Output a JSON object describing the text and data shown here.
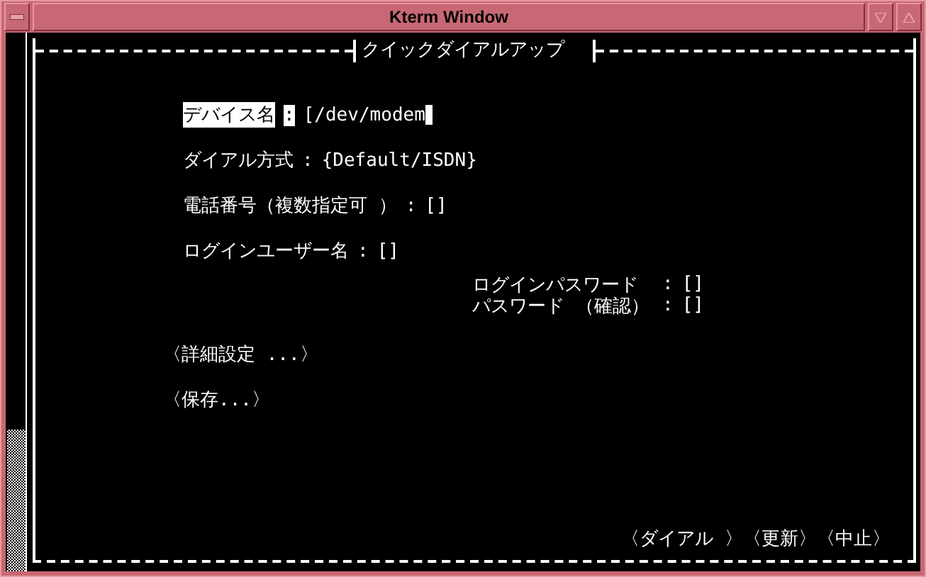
{
  "window": {
    "title": "Kterm Window"
  },
  "dialog": {
    "title": "クイックダイアルアップ",
    "fields": [
      {
        "kind": "main",
        "label": "デバイス名",
        "separator": ":",
        "value": "[/dev/modem",
        "selected": true
      },
      {
        "kind": "main",
        "label": "ダイアル方式",
        "separator": ":",
        "value": "{Default/ISDN}",
        "selected": false
      },
      {
        "kind": "main",
        "label": "電話番号（複数指定可 ）",
        "separator": ":",
        "value": "[]",
        "selected": false
      },
      {
        "kind": "main",
        "label": "ログインユーザー名",
        "separator": ":",
        "value": "[]",
        "selected": false
      },
      {
        "kind": "sub",
        "label": "ログインパスワード",
        "separator": ":",
        "value": "[]",
        "selected": false
      },
      {
        "kind": "sub",
        "label": "パスワード （確認）",
        "separator": ":",
        "value": "[]",
        "selected": false
      }
    ],
    "actions": [
      "〈詳細設定 ...〉",
      "〈保存...〉"
    ],
    "buttons": [
      "〈ダイアル 〉",
      "〈更新〉",
      "〈中止〉"
    ]
  }
}
